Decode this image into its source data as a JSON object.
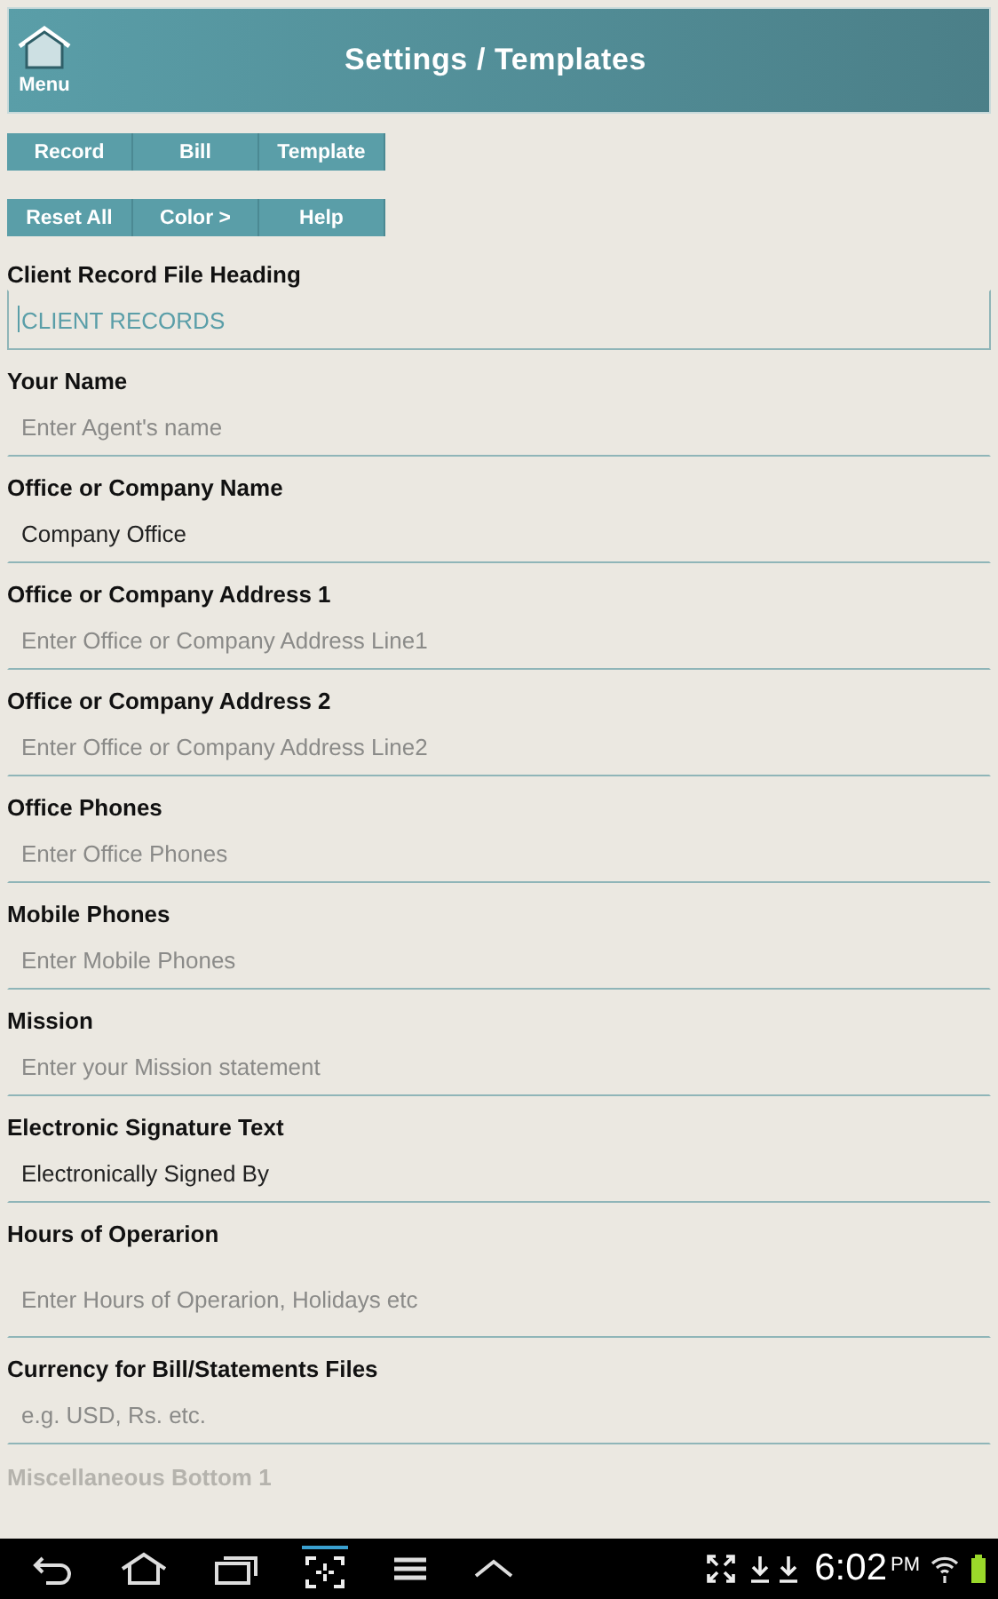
{
  "header": {
    "menu_label": "Menu",
    "title": "Settings / Templates"
  },
  "button_rows": [
    [
      "Record",
      "Bill",
      "Template"
    ],
    [
      "Reset All",
      "Color >",
      "Help"
    ]
  ],
  "fields": [
    {
      "label": "Client Record File Heading",
      "value": "CLIENT RECORDS",
      "focused": true,
      "kind": "single"
    },
    {
      "label": "Your Name",
      "placeholder": "Enter Agent's name",
      "focused": false,
      "kind": "single"
    },
    {
      "label": "Office or Company Name",
      "value": "Company Office",
      "focused": false,
      "kind": "single"
    },
    {
      "label": "Office or Company Address 1",
      "placeholder": "Enter Office or Company Address Line1",
      "focused": false,
      "kind": "single"
    },
    {
      "label": "Office or Company Address 2",
      "placeholder": "Enter Office or Company Address Line2",
      "focused": false,
      "kind": "single"
    },
    {
      "label": "Office Phones",
      "placeholder": "Enter Office Phones",
      "focused": false,
      "kind": "single"
    },
    {
      "label": "Mobile Phones",
      "placeholder": "Enter Mobile Phones",
      "focused": false,
      "kind": "single"
    },
    {
      "label": "Mission",
      "placeholder": "Enter your Mission statement",
      "focused": false,
      "kind": "single"
    },
    {
      "label": "Electronic Signature Text",
      "value": "Electronically Signed By",
      "focused": false,
      "kind": "single"
    },
    {
      "label": "Hours of Operarion",
      "placeholder": "Enter Hours of Operarion, Holidays etc",
      "focused": false,
      "kind": "multiline"
    },
    {
      "label": "Currency for Bill/Statements Files",
      "placeholder": "e.g. USD, Rs. etc.",
      "focused": false,
      "kind": "single"
    }
  ],
  "partial_label": "Miscellaneous Bottom 1",
  "status_bar": {
    "time": "6:02",
    "ampm": "PM"
  }
}
